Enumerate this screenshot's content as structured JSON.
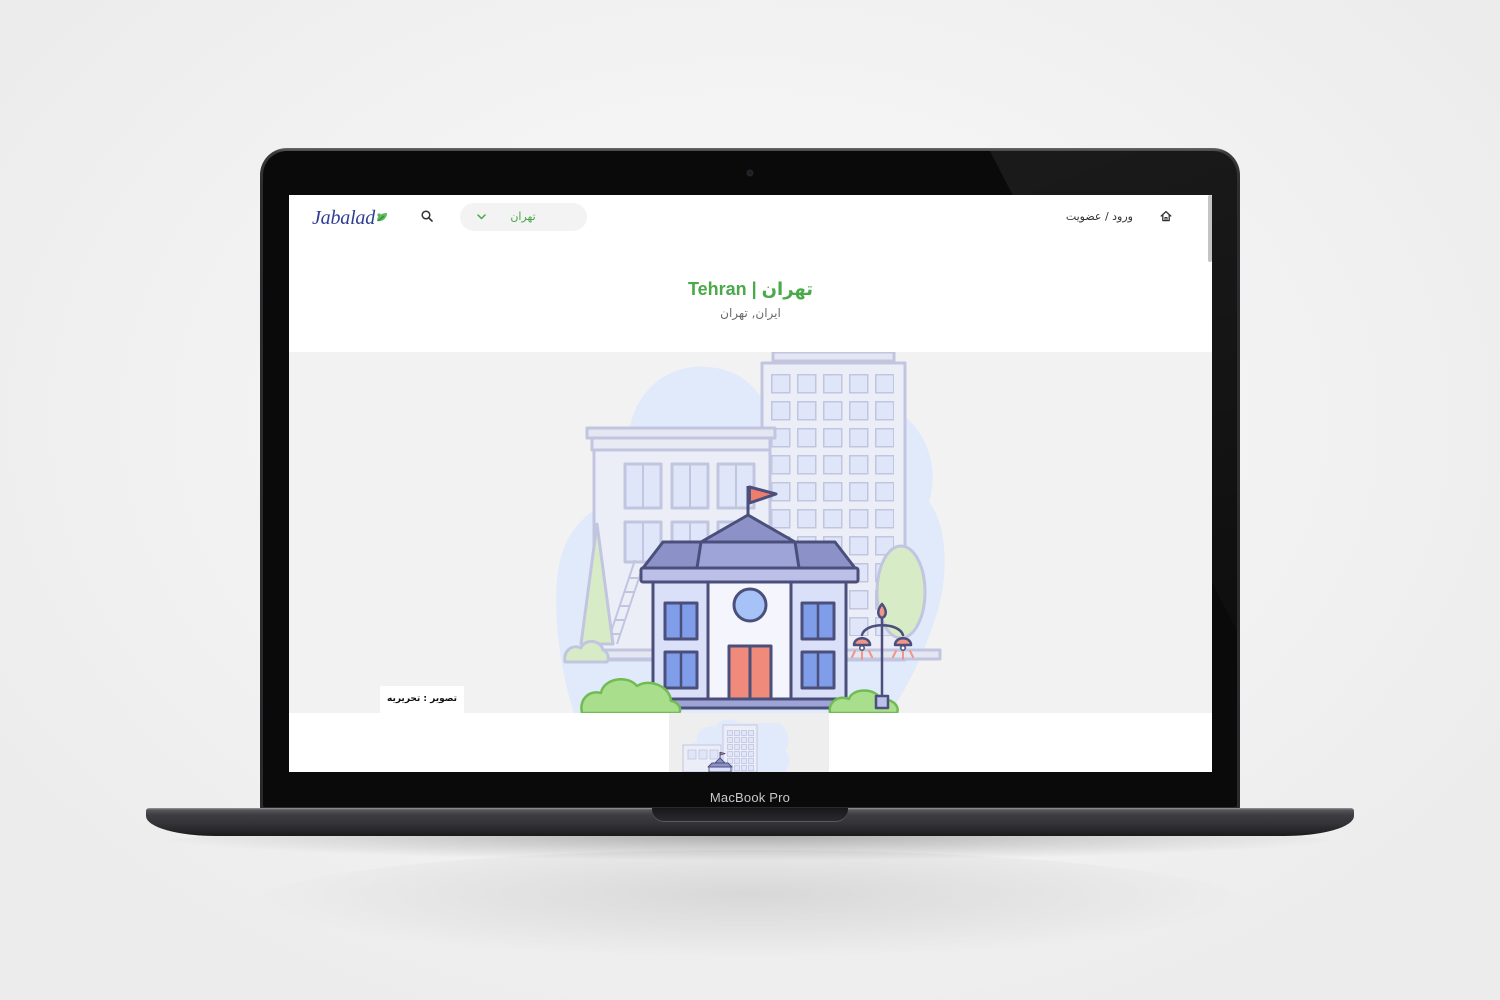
{
  "device": {
    "model_label": "MacBook Pro"
  },
  "site": {
    "logo": {
      "text": "Jabalad",
      "icon": "leaf-icon"
    },
    "search": {
      "icon": "search-icon"
    },
    "city_select": {
      "value": "تهران",
      "icon": "chevron-down-icon"
    },
    "auth_link": "ورود / عضویت",
    "home": {
      "icon": "home-icon"
    }
  },
  "hero": {
    "title": "تهران | Tehran",
    "subtitle": "ایران, تهران",
    "image_caption": "تصویر : تحریریه"
  },
  "colors": {
    "accent_green": "#4aa94a",
    "logo_blue": "#2f3e96",
    "text_dark": "#333333",
    "text_muted": "#6b6b6b",
    "image_background": "#f2f2f2",
    "illustration_outline": "#4b4f7c",
    "device_bezel": "#0a0a0b"
  }
}
